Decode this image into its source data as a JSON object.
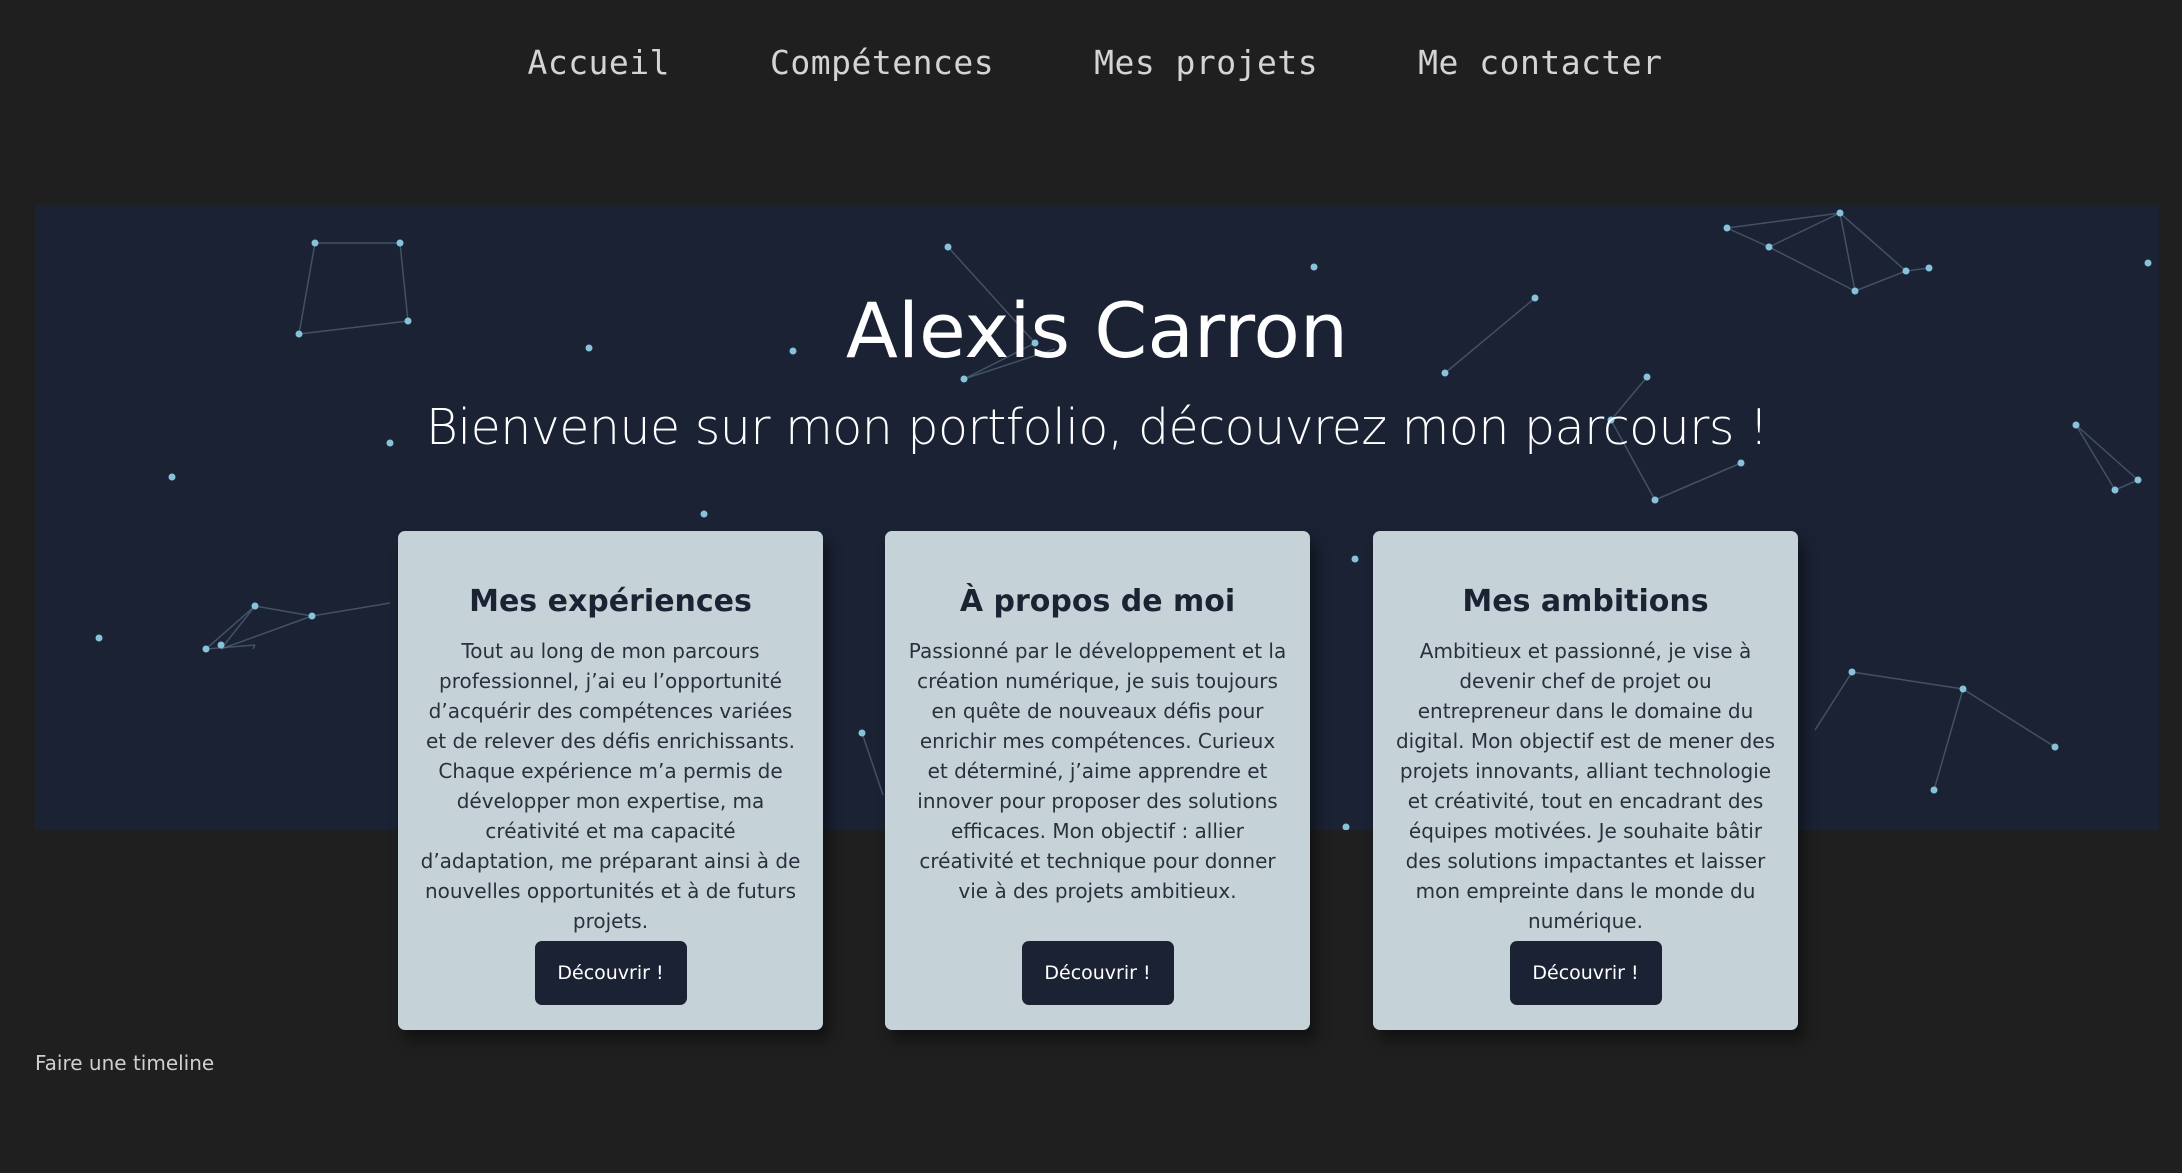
{
  "nav": {
    "items": [
      {
        "label": "Accueil"
      },
      {
        "label": "Compétences"
      },
      {
        "label": "Mes projets"
      },
      {
        "label": "Me contacter"
      }
    ]
  },
  "hero": {
    "title": "Alexis Carron",
    "subtitle": "Bienvenue sur mon portfolio, découvrez mon parcours !"
  },
  "cards": [
    {
      "title": "Mes expériences",
      "text": "Tout au long de mon parcours professionnel, j’ai eu l’opportunité d’acquérir des compétences variées et de relever des défis enrichissants. Chaque expérience m’a permis de développer mon expertise, ma créativité et ma capacité d’adaptation, me préparant ainsi à de nouvelles opportunités et à de futurs projets.",
      "button": "Découvrir !"
    },
    {
      "title": "À propos de moi",
      "text": "Passionné par le développement et la création numérique, je suis toujours en quête de nouveaux défis pour enrichir mes compétences. Curieux et déterminé, j’aime apprendre et innover pour proposer des solutions efficaces. Mon objectif : allier créativité et technique pour donner vie à des projets ambitieux.",
      "button": "Découvrir !"
    },
    {
      "title": "Mes ambitions",
      "text": "Ambitieux et passionné, je vise à devenir chef de projet ou entrepreneur dans le domaine du digital. Mon objectif est de mener des projets innovants, alliant technologie et créativité, tout en encadrant des équipes motivées. Je souhaite bâtir des solutions impactantes et laisser mon empreinte dans le monde du numérique.",
      "button": "Découvrir !"
    }
  ],
  "footer": {
    "note": "Faire une timeline"
  },
  "colors": {
    "page_background": "#1f1f1f",
    "hero_background": "#1a2234",
    "card_background": "#c5d3d8",
    "button_background": "#1a2234",
    "particle": "#7fbfd6"
  }
}
